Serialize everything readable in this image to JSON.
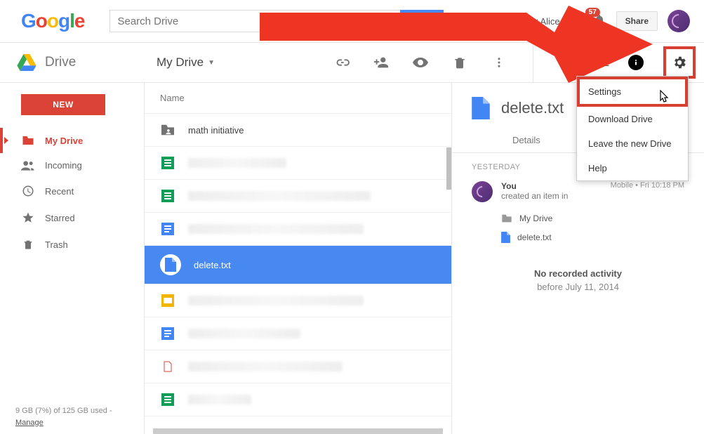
{
  "header": {
    "search_placeholder": "Search Drive",
    "plus_user": "+Alice",
    "notif_count": "57",
    "share_label": "Share"
  },
  "toolbar": {
    "brand": "Drive",
    "location": "My Drive",
    "sort_label": "AZ"
  },
  "sidebar": {
    "new_label": "NEW",
    "items": [
      {
        "label": "My Drive",
        "icon": "folder"
      },
      {
        "label": "Incoming",
        "icon": "people"
      },
      {
        "label": "Recent",
        "icon": "clock"
      },
      {
        "label": "Starred",
        "icon": "star"
      },
      {
        "label": "Trash",
        "icon": "trash"
      }
    ],
    "storage_line": "9 GB (7%) of 125 GB used -",
    "storage_manage": "Manage"
  },
  "filelist": {
    "column": "Name",
    "rows": [
      {
        "name": "math initiative",
        "icon": "folder-shared"
      },
      {
        "name": "",
        "icon": "sheet"
      },
      {
        "name": "",
        "icon": "sheet"
      },
      {
        "name": "",
        "icon": "doc"
      },
      {
        "name": "delete.txt",
        "icon": "file",
        "selected": true
      },
      {
        "name": "",
        "icon": "slides"
      },
      {
        "name": "",
        "icon": "doc"
      },
      {
        "name": "",
        "icon": "pdf"
      },
      {
        "name": "",
        "icon": "sheet"
      }
    ]
  },
  "details": {
    "title": "delete.txt",
    "tab": "Details",
    "group": "YESTERDAY",
    "actor": "You",
    "action": "created an item in",
    "when": "Mobile • Fri 10:18 PM",
    "loc_label": "My Drive",
    "file_label": "delete.txt",
    "empty1": "No recorded activity",
    "empty2": "before July 11, 2014"
  },
  "menu": {
    "items": [
      "Settings",
      "Download Drive",
      "Leave the new Drive",
      "Help"
    ]
  }
}
